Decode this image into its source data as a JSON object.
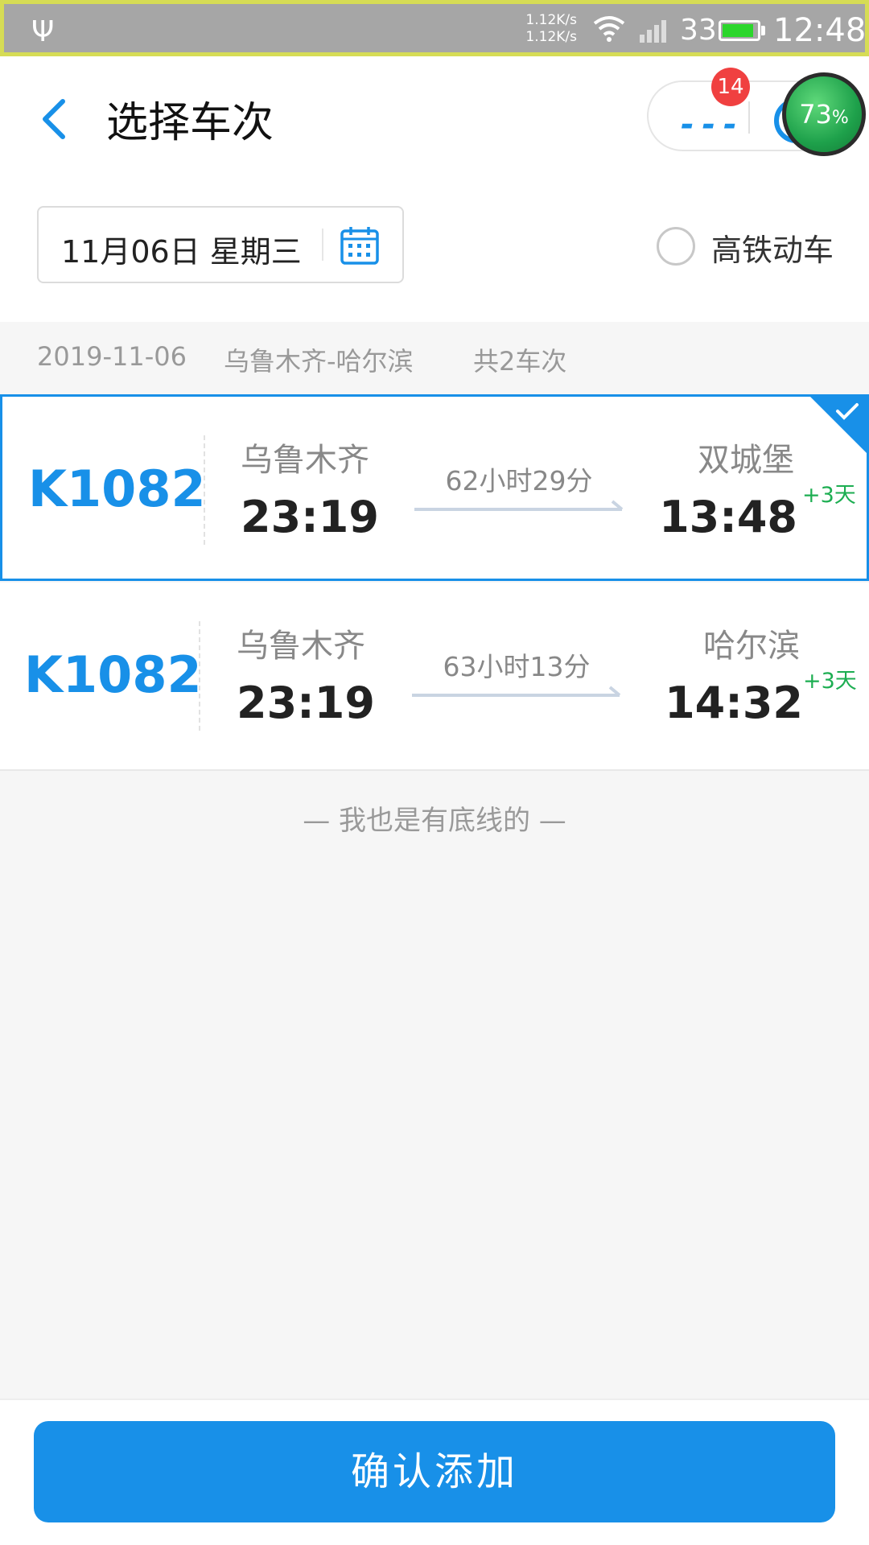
{
  "status_bar": {
    "net_up": "1.12K/s",
    "net_down": "1.12K/s",
    "signal_text": "33",
    "time": "12:48",
    "battery_level": 0.9
  },
  "header": {
    "title": "选择车次",
    "badge_count": "14",
    "float_percent": "73",
    "float_percent_sign": "%"
  },
  "filter": {
    "date": "11月06日 星期三",
    "high_speed_label": "高铁动车"
  },
  "summary": {
    "date": "2019-11-06",
    "route": "乌鲁木齐-哈尔滨",
    "count": "共2车次"
  },
  "trains": [
    {
      "number": "K1082",
      "from_station": "乌鲁木齐",
      "depart_time": "23:19",
      "duration": "62小时29分",
      "to_station": "双城堡",
      "arrive_time": "13:48",
      "day_offset": "+3天",
      "selected": true
    },
    {
      "number": "K1082",
      "from_station": "乌鲁木齐",
      "depart_time": "23:19",
      "duration": "63小时13分",
      "to_station": "哈尔滨",
      "arrive_time": "14:32",
      "day_offset": "+3天",
      "selected": false
    }
  ],
  "footer_note": "— 我也是有底线的 —",
  "confirm_label": "确认添加",
  "colors": {
    "accent": "#1890e8",
    "day_offset": "#1dae52",
    "badge": "#f04040"
  }
}
